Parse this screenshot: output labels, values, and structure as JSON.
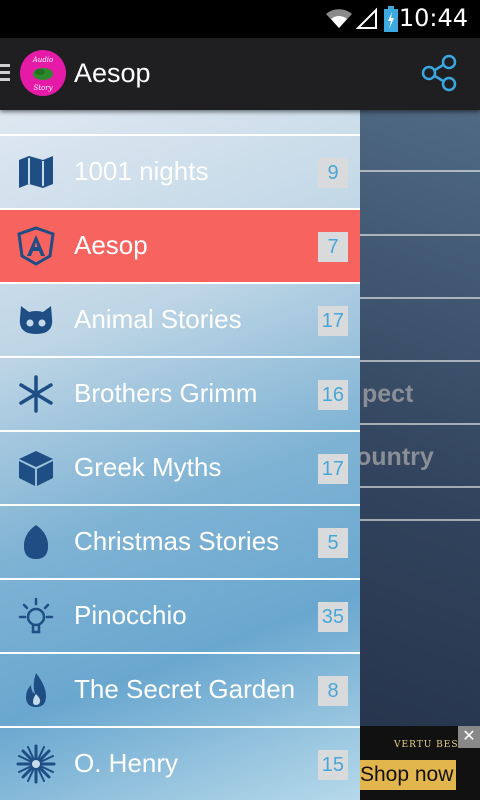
{
  "status_bar": {
    "time": "10:44"
  },
  "app_bar": {
    "title": "Aesop",
    "logo_text_line1": "Audio",
    "logo_text_line2": "Story"
  },
  "background": {
    "text_1": "pect",
    "text_2": "ountry"
  },
  "ad": {
    "brand": "VERTU BEST",
    "button_label": "Shop now",
    "close_label": "✕"
  },
  "drawer": {
    "active_color": "#f7635f",
    "items": [
      {
        "label": "1001 nights",
        "count": "9",
        "icon": "map-icon"
      },
      {
        "label": "Aesop",
        "count": "7",
        "icon": "angular-shield-icon",
        "active": true
      },
      {
        "label": "Animal Stories",
        "count": "17",
        "icon": "github-cat-icon"
      },
      {
        "label": "Brothers Grimm",
        "count": "16",
        "icon": "asterisk-icon"
      },
      {
        "label": "Greek Myths",
        "count": "17",
        "icon": "cube-icon"
      },
      {
        "label": "Christmas Stories",
        "count": "5",
        "icon": "egg-icon"
      },
      {
        "label": "Pinocchio",
        "count": "35",
        "icon": "lightbulb-icon"
      },
      {
        "label": "The Secret Garden",
        "count": "8",
        "icon": "fire-icon"
      },
      {
        "label": "O. Henry",
        "count": "15",
        "icon": "snowflake-icon"
      }
    ]
  }
}
